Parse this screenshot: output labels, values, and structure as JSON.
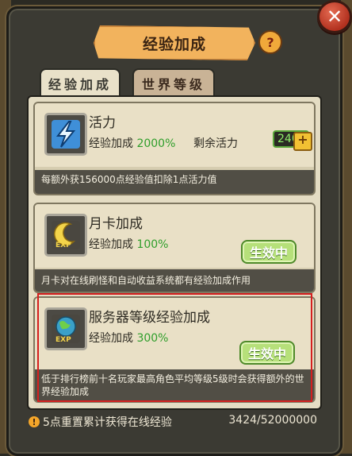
{
  "window": {
    "title": "经验加成",
    "close_label": "✕",
    "help_label": "?"
  },
  "tabs": [
    {
      "label": "经验加成",
      "active": true
    },
    {
      "label": "世界等级",
      "active": false
    }
  ],
  "cards": [
    {
      "title": "活力",
      "bonus_label": "经验加成",
      "bonus_value": "2000%",
      "remaining_label": "剩余活力",
      "remaining_value": "240",
      "description": "每额外获156000点经验值扣除1点活力值",
      "icon": "lightning-icon"
    },
    {
      "title": "月卡加成",
      "bonus_label": "经验加成",
      "bonus_value": "100%",
      "status": "生效中",
      "description": "月卡对在线刷怪和自动收益系统都有经验加成作用",
      "icon": "moon-exp-icon"
    },
    {
      "title": "服务器等级经验加成",
      "bonus_label": "经验加成",
      "bonus_value": "300%",
      "status": "生效中",
      "description": "低于排行榜前十名玩家最高角色平均等级5级时会获得额外的世界经验加成",
      "icon": "globe-exp-icon"
    }
  ],
  "footer": {
    "note": "5点重置累计获得在线经验",
    "progress": "3424/52000000"
  },
  "colors": {
    "accent": "#f2b35d",
    "green": "#2f9e2b",
    "highlight": "#d51f1f"
  }
}
